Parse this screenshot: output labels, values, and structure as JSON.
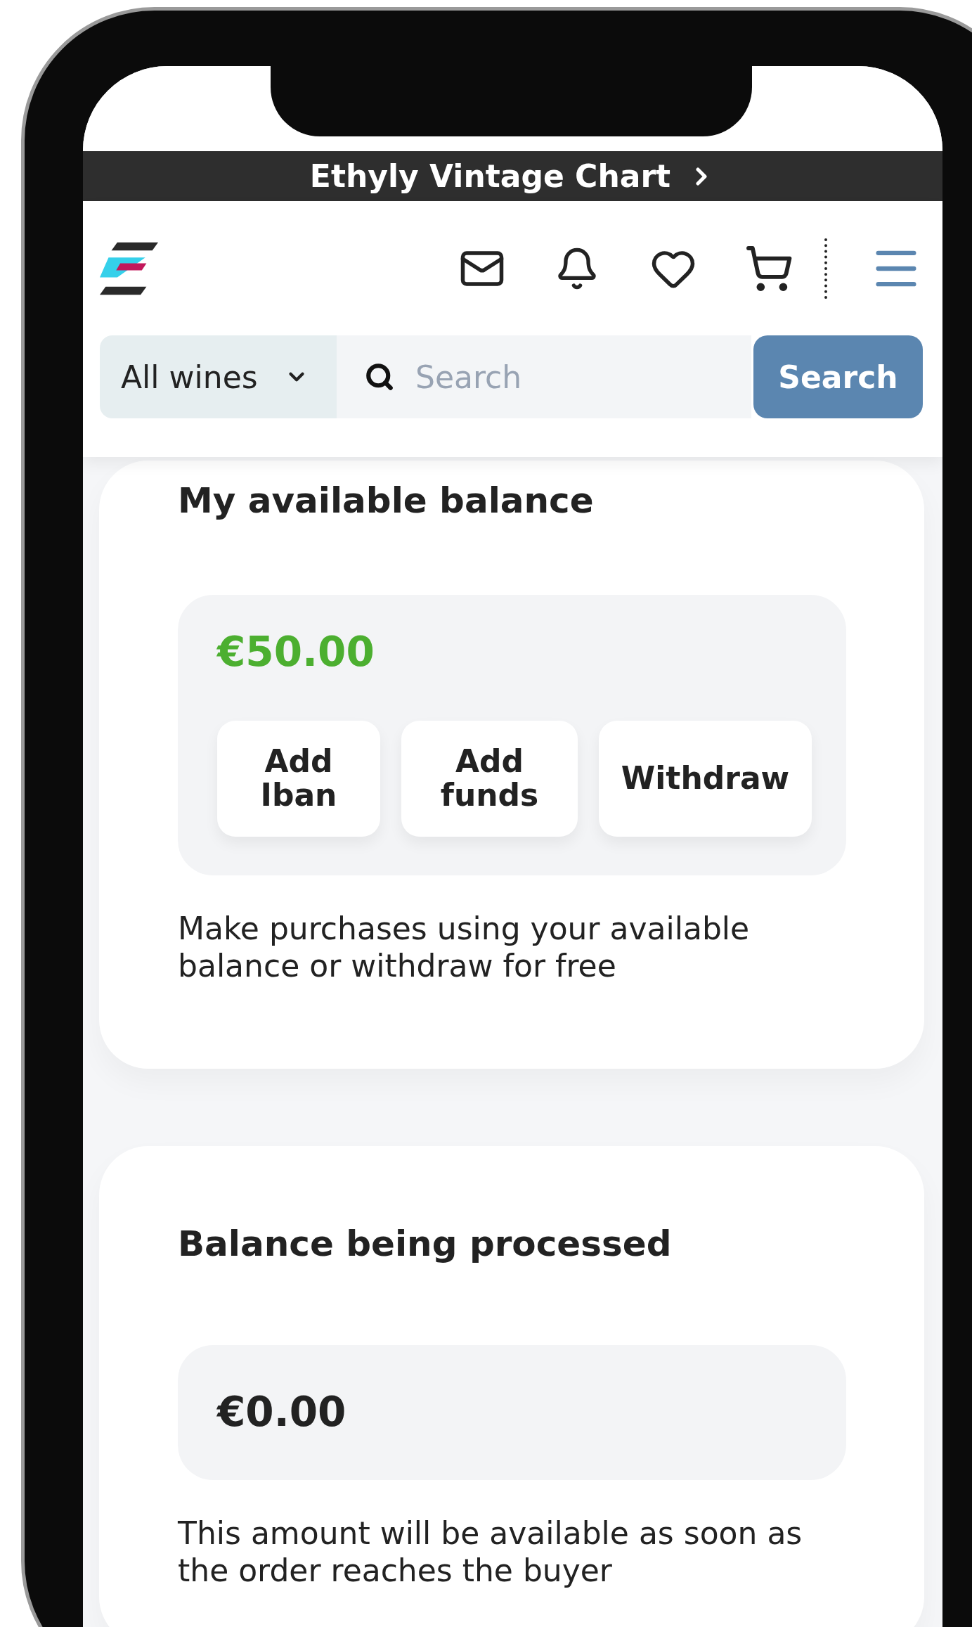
{
  "banner": {
    "label": "Ethyly Vintage Chart"
  },
  "search": {
    "category": "All wines",
    "placeholder": "Search",
    "button": "Search"
  },
  "cards": [
    {
      "kind": "available",
      "title": "My available balance",
      "amount": "€50.00",
      "actions": [
        "Add Iban",
        "Add funds",
        "Withdraw"
      ],
      "note": "Make purchases using your available balance or withdraw for free"
    },
    {
      "kind": "processing",
      "title": "Balance being processed",
      "amount": "€0.00",
      "note": "This amount will be available as soon as the order reaches the buyer"
    }
  ]
}
